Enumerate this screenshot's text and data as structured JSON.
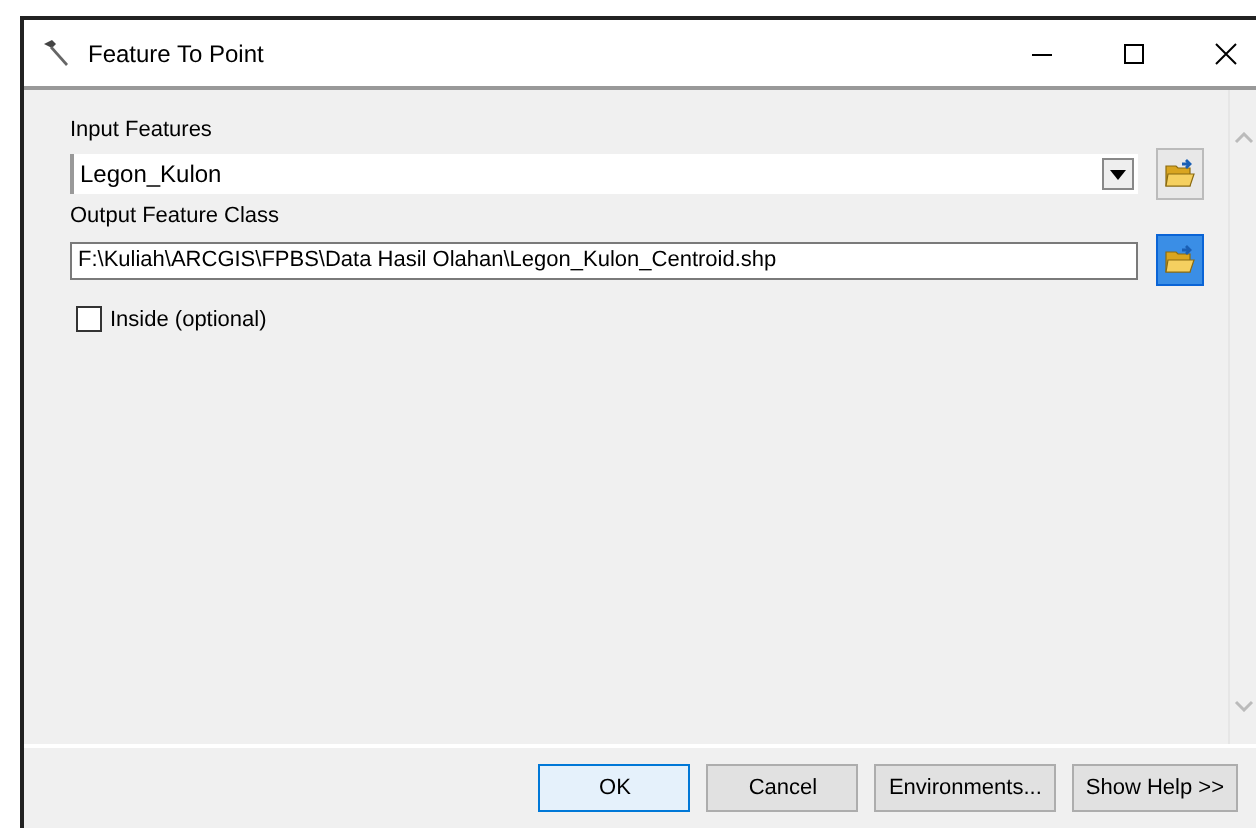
{
  "window": {
    "title": "Feature To Point"
  },
  "fields": [
    {
      "label": "Input Features",
      "value": "Legon_Kulon",
      "kind": "dropdown",
      "focused": false
    },
    {
      "label": "Output Feature Class",
      "value": "F:\\Kuliah\\ARCGIS\\FPBS\\Data Hasil Olahan\\Legon_Kulon_Centroid.shp",
      "kind": "text",
      "focused": true
    }
  ],
  "options": [
    {
      "label": "Inside (optional)",
      "checked": false
    }
  ],
  "buttons": [
    {
      "label": "OK",
      "default": true
    },
    {
      "label": "Cancel",
      "default": false
    },
    {
      "label": "Environments...",
      "default": false
    },
    {
      "label": "Show Help >>",
      "default": false
    }
  ]
}
